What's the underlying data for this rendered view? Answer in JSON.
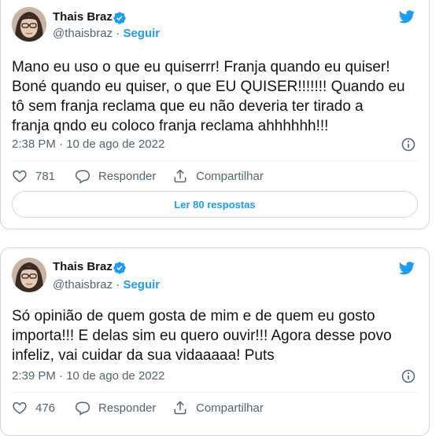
{
  "tweets": [
    {
      "author": {
        "name": "Thais Braz",
        "handle": "@thaisbraz",
        "separator": "·",
        "follow_label": "Seguir"
      },
      "text": "Mano eu uso o que eu quiserrr! Franja quando eu quiser!\nBoné quando eu quiser, o que EU QUISER!!!!!!! Quando eu\ntô sem franja reclama que eu não deveria ter tirado a\nfranja qndo eu coloco franja reclama ahhhhhh!!!",
      "timestamp": "2:38 PM · 10 de ago de 2022",
      "likes": "781",
      "reply_label": "Responder",
      "share_label": "Compartilhar",
      "read_replies_label": "Ler 80 respostas"
    },
    {
      "author": {
        "name": "Thais Braz",
        "handle": "@thaisbraz",
        "separator": "·",
        "follow_label": "Seguir"
      },
      "text": "Só opinião de quem gosta de mim e de quem eu gosto\nimporta!!! E delas sim eu quero ouvir!!! Agora desse povo\ninfeliz, vai cuidar da sua vidaaaaa! Puts",
      "timestamp": "2:39 PM · 10 de ago de 2022",
      "likes": "476",
      "reply_label": "Responder",
      "share_label": "Compartilhar"
    }
  ],
  "icons": {
    "verified": "verified-badge-icon",
    "brand": "twitter-bird-icon",
    "info": "info-icon",
    "like": "heart-icon",
    "reply": "reply-bubble-icon",
    "share": "share-icon"
  },
  "colors": {
    "accent": "#1d9bf0",
    "text": "#0f1419",
    "muted": "#536471",
    "border": "#cfd9de"
  }
}
